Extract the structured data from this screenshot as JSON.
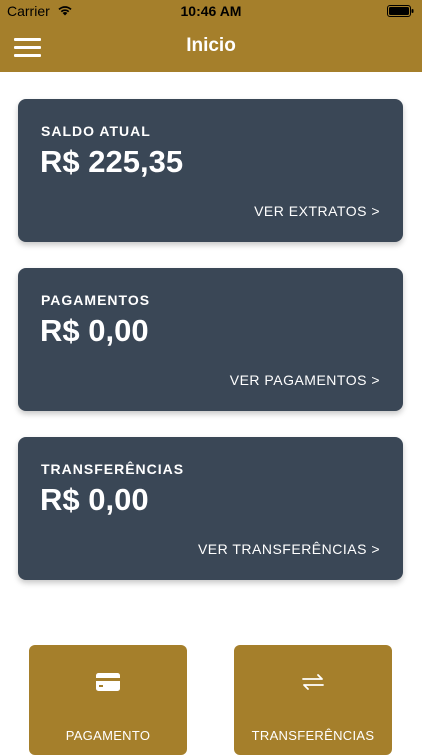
{
  "status_bar": {
    "carrier": "Carrier",
    "time": "10:46 AM"
  },
  "nav": {
    "title": "Inicio",
    "menu_icon": "hamburger-menu-icon"
  },
  "cards": [
    {
      "label": "SALDO ATUAL",
      "value": "R$ 225,35",
      "link": "VER EXTRATOS >"
    },
    {
      "label": "PAGAMENTOS",
      "value": "R$ 0,00",
      "link": "VER PAGAMENTOS >"
    },
    {
      "label": "TRANSFERÊNCIAS",
      "value": "R$ 0,00",
      "link": "VER TRANSFERÊNCIAS >"
    }
  ],
  "actions": [
    {
      "label": "PAGAMENTO",
      "icon": "credit-card-icon"
    },
    {
      "label": "TRANSFERÊNCIAS",
      "icon": "transfer-arrows-icon"
    }
  ],
  "colors": {
    "brand": "#a57f2b",
    "card_bg": "#3a4756",
    "text_light": "#ffffff"
  }
}
